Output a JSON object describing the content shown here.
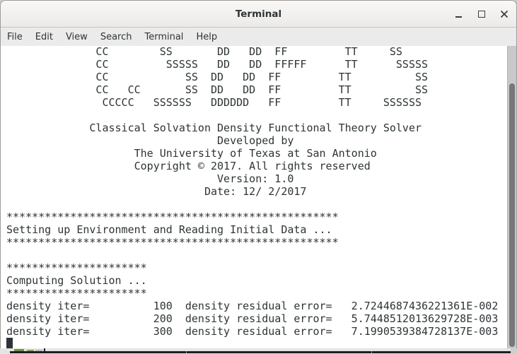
{
  "window": {
    "title": "Terminal",
    "controls": [
      "minimize",
      "maximize",
      "close"
    ]
  },
  "menu": {
    "items": [
      "File",
      "Edit",
      "View",
      "Search",
      "Terminal",
      "Help"
    ]
  },
  "terminal": {
    "lines": [
      "              CC        SS       DD   DD  FF         TT     SS",
      "              CC         SSSSS   DD   DD  FFFFF      TT      SSSSS",
      "              CC            SS  DD   DD  FF         TT          SS",
      "              CC   CC       SS  DD   DD  FF         TT          SS",
      "               CCCCC   SSSSSS   DDDDDD   FF         TT     SSSSSS",
      "",
      "             Classical Solvation Density Functional Theory Solver",
      "                                 Developed by",
      "                    The University of Texas at San Antonio",
      "                    Copyright © 2017. All rights reserved",
      "                                 Version: 1.0",
      "                               Date: 12/ 2/2017",
      "",
      "****************************************************",
      "Setting up Environment and Reading Initial Data ...",
      "****************************************************",
      "",
      "**********************",
      "Computing Solution ...",
      "**********************",
      "density iter=          100  density residual error=   2.7244687436221361E-002",
      "density iter=          200  density residual error=   5.7448512013629728E-003",
      "density iter=          300  density residual error=   7.1990539384728137E-003"
    ],
    "cursor_row": 23,
    "cursor_col": 0
  },
  "colors": {
    "terminal_fg": "#2e3436",
    "terminal_bg": "#ffffff"
  }
}
